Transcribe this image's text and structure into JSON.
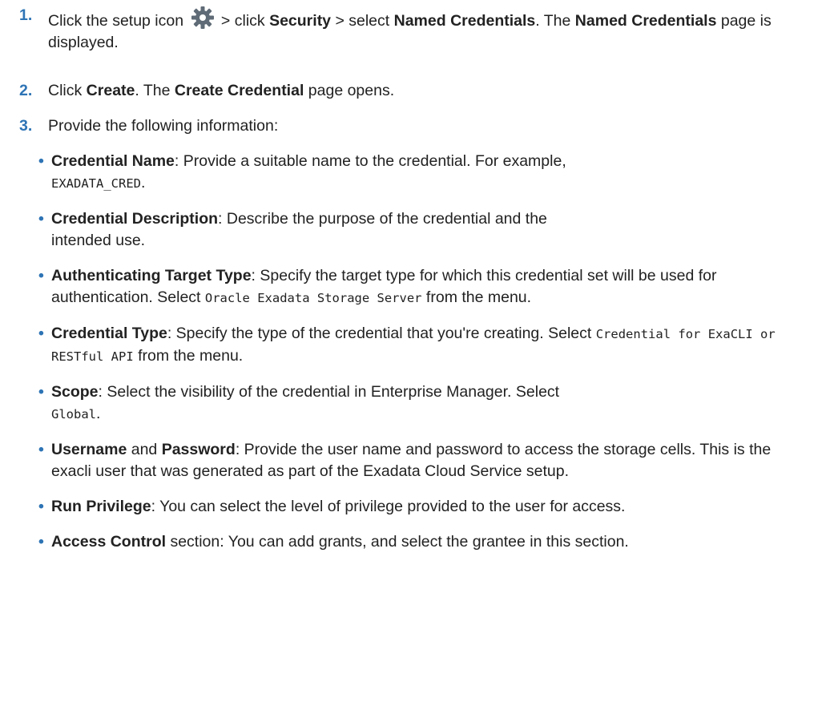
{
  "accent_color": "#2e74b5",
  "steps": [
    {
      "number": "1.",
      "part_a": "Click the setup icon",
      "icon": "gear-icon",
      "part_b": " > click ",
      "b1": "Security",
      "part_c": " > select ",
      "b2": "Named Credentials",
      "part_d": ". The ",
      "b3": "Named Credentials",
      "part_e": " page is displayed."
    },
    {
      "number": "2.",
      "part_a": "Click ",
      "b1": "Create",
      "part_b": ". The ",
      "b2": "Create Credential",
      "part_c": " page opens."
    },
    {
      "number": "3.",
      "text": "Provide the following information:"
    }
  ],
  "bullet_glyph": "•",
  "fields": [
    {
      "b1": "Credential Name",
      "t1": ": Provide a suitable name to the credential. For example, ",
      "m1": "EXADATA_CRED",
      "t2": "."
    },
    {
      "b1": "Credential Description",
      "t1": ": Describe the purpose of the credential and the intended use."
    },
    {
      "b1": "Authenticating Target Type",
      "t1": ": Specify the target type for which this credential set will be used for authentication. Select ",
      "m1": "Oracle Exadata Storage Server",
      "t2": " from the menu."
    },
    {
      "b1": "Credential Type",
      "t1": ": Specify the type of the credential that you're creating. Select ",
      "m1": "Credential for ExaCLI or RESTful API",
      "t2": " from the menu."
    },
    {
      "b1": "Scope",
      "t1": ": Select the visibility of the credential in Enterprise Manager. Select ",
      "m1": "Global",
      "t2": "."
    },
    {
      "b1": "Username",
      "t1": " and ",
      "b2": "Password",
      "t2": ": Provide the user name and password to access the storage cells. This is the exacli user that was generated as part of the Exadata Cloud Service setup."
    },
    {
      "b1": "Run Privilege",
      "t1": ": You can select the level of privilege provided to the user for access."
    },
    {
      "b1": "Access Control",
      "t1": " section: You can add grants, and select the grantee in this section."
    }
  ]
}
